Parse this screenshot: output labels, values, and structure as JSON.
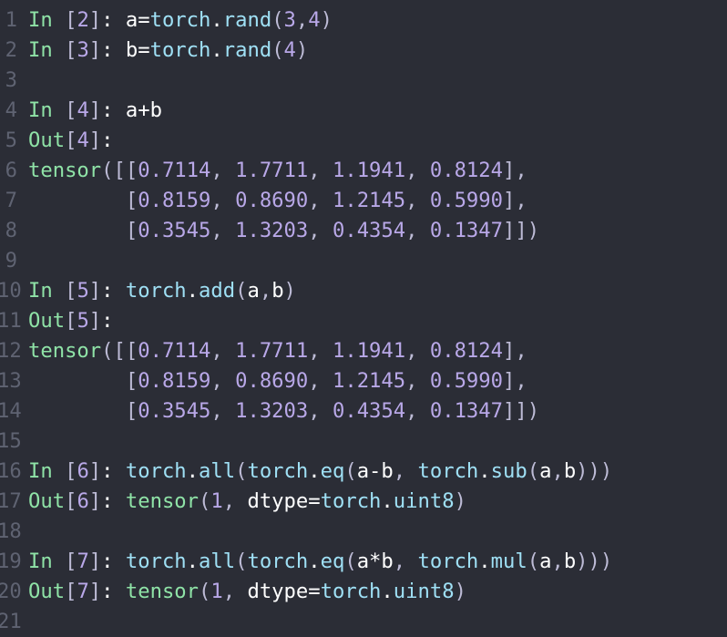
{
  "lines": [
    {
      "n": "1",
      "tokens": [
        [
          "k",
          "In"
        ],
        [
          "br",
          " ["
        ],
        [
          "n",
          "2"
        ],
        [
          "br",
          "]"
        ],
        [
          "f",
          ":"
        ],
        [
          "f",
          " a="
        ],
        [
          "p",
          "torch"
        ],
        [
          "f",
          "."
        ],
        [
          "fn",
          "rand"
        ],
        [
          "br",
          "("
        ],
        [
          "n",
          "3"
        ],
        [
          "br",
          ","
        ],
        [
          "n",
          "4"
        ],
        [
          "br",
          ")"
        ]
      ]
    },
    {
      "n": "2",
      "tokens": [
        [
          "k",
          "In"
        ],
        [
          "br",
          " ["
        ],
        [
          "n",
          "3"
        ],
        [
          "br",
          "]"
        ],
        [
          "f",
          ":"
        ],
        [
          "f",
          " b="
        ],
        [
          "p",
          "torch"
        ],
        [
          "f",
          "."
        ],
        [
          "fn",
          "rand"
        ],
        [
          "br",
          "("
        ],
        [
          "n",
          "4"
        ],
        [
          "br",
          ")"
        ]
      ]
    },
    {
      "n": "3",
      "tokens": []
    },
    {
      "n": "4",
      "tokens": [
        [
          "k",
          "In"
        ],
        [
          "br",
          " ["
        ],
        [
          "n",
          "4"
        ],
        [
          "br",
          "]"
        ],
        [
          "f",
          ":"
        ],
        [
          "f",
          " a+b"
        ]
      ]
    },
    {
      "n": "5",
      "tokens": [
        [
          "k",
          "Out"
        ],
        [
          "br",
          "["
        ],
        [
          "n",
          "4"
        ],
        [
          "br",
          "]"
        ],
        [
          "f",
          ":"
        ]
      ]
    },
    {
      "n": "6",
      "tokens": [
        [
          "t",
          "tensor"
        ],
        [
          "br",
          "([["
        ],
        [
          "n",
          "0.7114"
        ],
        [
          "br",
          ", "
        ],
        [
          "n",
          "1.7711"
        ],
        [
          "br",
          ", "
        ],
        [
          "n",
          "1.1941"
        ],
        [
          "br",
          ", "
        ],
        [
          "n",
          "0.8124"
        ],
        [
          "br",
          "],"
        ]
      ]
    },
    {
      "n": "7",
      "tokens": [
        [
          "f",
          "        "
        ],
        [
          "br",
          "["
        ],
        [
          "n",
          "0.8159"
        ],
        [
          "br",
          ", "
        ],
        [
          "n",
          "0.8690"
        ],
        [
          "br",
          ", "
        ],
        [
          "n",
          "1.2145"
        ],
        [
          "br",
          ", "
        ],
        [
          "n",
          "0.5990"
        ],
        [
          "br",
          "],"
        ]
      ]
    },
    {
      "n": "8",
      "tokens": [
        [
          "f",
          "        "
        ],
        [
          "br",
          "["
        ],
        [
          "n",
          "0.3545"
        ],
        [
          "br",
          ", "
        ],
        [
          "n",
          "1.3203"
        ],
        [
          "br",
          ", "
        ],
        [
          "n",
          "0.4354"
        ],
        [
          "br",
          ", "
        ],
        [
          "n",
          "0.1347"
        ],
        [
          "br",
          "]])"
        ]
      ]
    },
    {
      "n": "9",
      "tokens": []
    },
    {
      "n": "10",
      "tokens": [
        [
          "k",
          "In"
        ],
        [
          "br",
          " ["
        ],
        [
          "n",
          "5"
        ],
        [
          "br",
          "]"
        ],
        [
          "f",
          ":"
        ],
        [
          "f",
          " "
        ],
        [
          "p",
          "torch"
        ],
        [
          "f",
          "."
        ],
        [
          "fn",
          "add"
        ],
        [
          "br",
          "("
        ],
        [
          "f",
          "a"
        ],
        [
          "br",
          ","
        ],
        [
          "f",
          "b"
        ],
        [
          "br",
          ")"
        ]
      ]
    },
    {
      "n": "11",
      "tokens": [
        [
          "k",
          "Out"
        ],
        [
          "br",
          "["
        ],
        [
          "n",
          "5"
        ],
        [
          "br",
          "]"
        ],
        [
          "f",
          ":"
        ]
      ]
    },
    {
      "n": "12",
      "tokens": [
        [
          "t",
          "tensor"
        ],
        [
          "br",
          "([["
        ],
        [
          "n",
          "0.7114"
        ],
        [
          "br",
          ", "
        ],
        [
          "n",
          "1.7711"
        ],
        [
          "br",
          ", "
        ],
        [
          "n",
          "1.1941"
        ],
        [
          "br",
          ", "
        ],
        [
          "n",
          "0.8124"
        ],
        [
          "br",
          "],"
        ]
      ]
    },
    {
      "n": "13",
      "tokens": [
        [
          "f",
          "        "
        ],
        [
          "br",
          "["
        ],
        [
          "n",
          "0.8159"
        ],
        [
          "br",
          ", "
        ],
        [
          "n",
          "0.8690"
        ],
        [
          "br",
          ", "
        ],
        [
          "n",
          "1.2145"
        ],
        [
          "br",
          ", "
        ],
        [
          "n",
          "0.5990"
        ],
        [
          "br",
          "],"
        ]
      ]
    },
    {
      "n": "14",
      "tokens": [
        [
          "f",
          "        "
        ],
        [
          "br",
          "["
        ],
        [
          "n",
          "0.3545"
        ],
        [
          "br",
          ", "
        ],
        [
          "n",
          "1.3203"
        ],
        [
          "br",
          ", "
        ],
        [
          "n",
          "0.4354"
        ],
        [
          "br",
          ", "
        ],
        [
          "n",
          "0.1347"
        ],
        [
          "br",
          "]])"
        ]
      ]
    },
    {
      "n": "15",
      "tokens": []
    },
    {
      "n": "16",
      "tokens": [
        [
          "k",
          "In"
        ],
        [
          "br",
          " ["
        ],
        [
          "n",
          "6"
        ],
        [
          "br",
          "]"
        ],
        [
          "f",
          ":"
        ],
        [
          "f",
          " "
        ],
        [
          "p",
          "torch"
        ],
        [
          "f",
          "."
        ],
        [
          "fn",
          "all"
        ],
        [
          "br",
          "("
        ],
        [
          "p",
          "torch"
        ],
        [
          "f",
          "."
        ],
        [
          "fn",
          "eq"
        ],
        [
          "br",
          "("
        ],
        [
          "f",
          "a-b"
        ],
        [
          "br",
          ", "
        ],
        [
          "p",
          "torch"
        ],
        [
          "f",
          "."
        ],
        [
          "fn",
          "sub"
        ],
        [
          "br",
          "("
        ],
        [
          "f",
          "a"
        ],
        [
          "br",
          ","
        ],
        [
          "f",
          "b"
        ],
        [
          "br",
          ")))"
        ]
      ]
    },
    {
      "n": "17",
      "tokens": [
        [
          "k",
          "Out"
        ],
        [
          "br",
          "["
        ],
        [
          "n",
          "6"
        ],
        [
          "br",
          "]"
        ],
        [
          "f",
          ":"
        ],
        [
          "f",
          " "
        ],
        [
          "t",
          "tensor"
        ],
        [
          "br",
          "("
        ],
        [
          "n",
          "1"
        ],
        [
          "br",
          ", "
        ],
        [
          "f",
          "dtype="
        ],
        [
          "p",
          "torch"
        ],
        [
          "f",
          "."
        ],
        [
          "fn",
          "uint8"
        ],
        [
          "br",
          ")"
        ]
      ]
    },
    {
      "n": "18",
      "tokens": []
    },
    {
      "n": "19",
      "tokens": [
        [
          "k",
          "In"
        ],
        [
          "br",
          " ["
        ],
        [
          "n",
          "7"
        ],
        [
          "br",
          "]"
        ],
        [
          "f",
          ":"
        ],
        [
          "f",
          " "
        ],
        [
          "p",
          "torch"
        ],
        [
          "f",
          "."
        ],
        [
          "fn",
          "all"
        ],
        [
          "br",
          "("
        ],
        [
          "p",
          "torch"
        ],
        [
          "f",
          "."
        ],
        [
          "fn",
          "eq"
        ],
        [
          "br",
          "("
        ],
        [
          "f",
          "a*b"
        ],
        [
          "br",
          ", "
        ],
        [
          "p",
          "torch"
        ],
        [
          "f",
          "."
        ],
        [
          "fn",
          "mul"
        ],
        [
          "br",
          "("
        ],
        [
          "f",
          "a"
        ],
        [
          "br",
          ","
        ],
        [
          "f",
          "b"
        ],
        [
          "br",
          ")))"
        ]
      ]
    },
    {
      "n": "20",
      "tokens": [
        [
          "k",
          "Out"
        ],
        [
          "br",
          "["
        ],
        [
          "n",
          "7"
        ],
        [
          "br",
          "]"
        ],
        [
          "f",
          ":"
        ],
        [
          "f",
          " "
        ],
        [
          "t",
          "tensor"
        ],
        [
          "br",
          "("
        ],
        [
          "n",
          "1"
        ],
        [
          "br",
          ", "
        ],
        [
          "f",
          "dtype="
        ],
        [
          "p",
          "torch"
        ],
        [
          "f",
          "."
        ],
        [
          "fn",
          "uint8"
        ],
        [
          "br",
          ")"
        ]
      ]
    },
    {
      "n": "21",
      "tokens": []
    }
  ]
}
